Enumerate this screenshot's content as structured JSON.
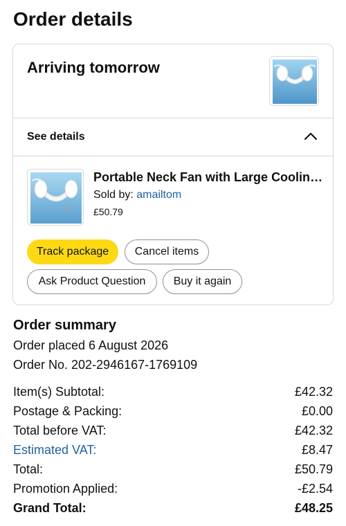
{
  "page": {
    "title": "Order details"
  },
  "shipment": {
    "status": "Arriving tomorrow",
    "see_details_label": "See details",
    "item": {
      "title": "Portable Neck Fan with Large Cooling Area",
      "sold_by_prefix": "Sold by:",
      "seller": "amailtom",
      "price": "£50.79"
    },
    "buttons": {
      "track": "Track package",
      "cancel": "Cancel items",
      "ask": "Ask Product Question",
      "buy_again": "Buy it again"
    }
  },
  "summary": {
    "title": "Order summary",
    "placed": "Order placed 6 August 2026",
    "order_no": "Order No. 202-2946167-1769109",
    "rows": [
      {
        "label": "Item(s) Subtotal:",
        "value": "£42.32"
      },
      {
        "label": "Postage & Packing:",
        "value": "£0.00"
      },
      {
        "label": "Total before VAT:",
        "value": "£42.32"
      },
      {
        "label": "Estimated VAT:",
        "value": "£8.47"
      },
      {
        "label": "Total:",
        "value": "£50.79"
      },
      {
        "label": "Promotion Applied:",
        "value": "-£2.54"
      },
      {
        "label": "Grand Total:",
        "value": "£48.25"
      }
    ]
  },
  "colors": {
    "primary_button": "#ffd814",
    "link": "#2162a1",
    "border": "#d5d9d9"
  },
  "icons": {
    "collapse": "chevron-up-icon",
    "product": "neck-fan-product-image"
  }
}
